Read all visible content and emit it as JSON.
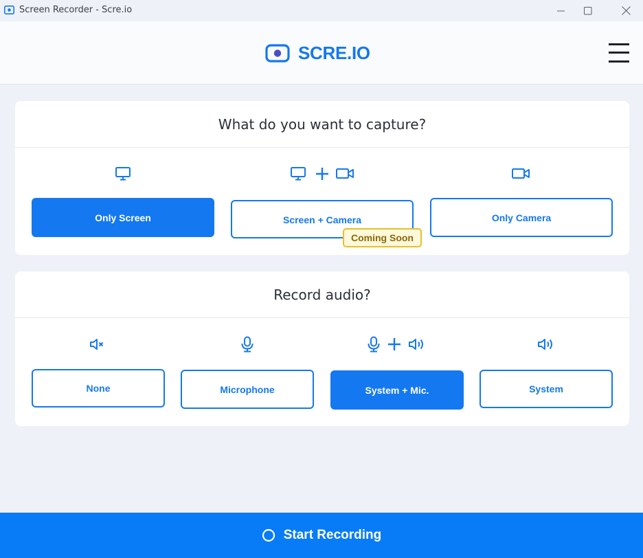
{
  "window": {
    "title": "Screen Recorder - Scre.io",
    "controls": [
      "minimize-icon",
      "maximize-icon",
      "close-icon"
    ]
  },
  "header": {
    "logo_text": "SCRE.IO",
    "logo_icon": "record-camera-icon",
    "menu_icon": "hamburger-menu-icon"
  },
  "capture": {
    "heading": "What do you want to capture?",
    "options": [
      {
        "label": "Only Screen",
        "icon": "monitor-icon",
        "selected": true
      },
      {
        "label": "Screen + Camera",
        "icon": "monitor-plus-camera-icon",
        "selected": false,
        "badge": "Coming Soon"
      },
      {
        "label": "Only Camera",
        "icon": "video-camera-icon",
        "selected": false
      }
    ]
  },
  "audio": {
    "heading": "Record audio?",
    "options": [
      {
        "label": "None",
        "icon": "speaker-muted-icon",
        "selected": false
      },
      {
        "label": "Microphone",
        "icon": "microphone-icon",
        "selected": false
      },
      {
        "label": "System + Mic.",
        "icon": "microphone-plus-speaker-icon",
        "selected": true
      },
      {
        "label": "System",
        "icon": "speaker-icon",
        "selected": false
      }
    ]
  },
  "footer": {
    "start_label": "Start Recording",
    "start_icon": "record-circle-icon"
  },
  "colors": {
    "accent": "#1478f0",
    "footer": "#087cf7",
    "badge_border": "#e8bf27",
    "badge_text": "#8a6a05",
    "background": "#eef1f7"
  }
}
